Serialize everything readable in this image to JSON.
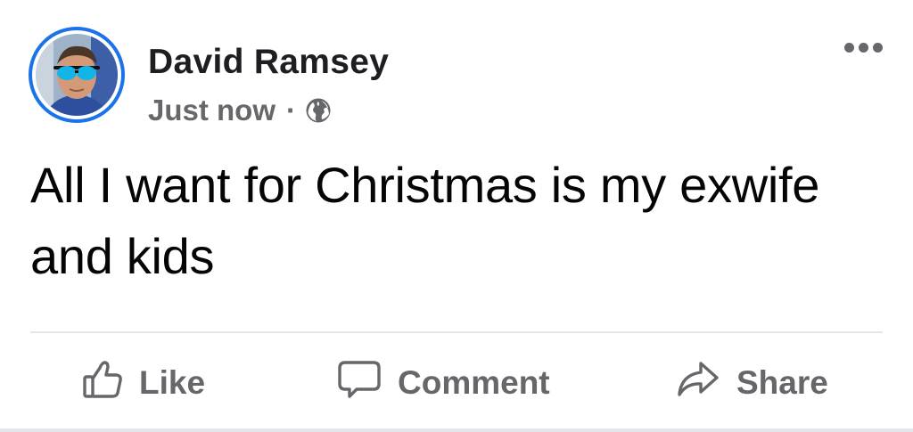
{
  "post": {
    "author": {
      "name": "David Ramsey",
      "avatar_icon": "profile-photo",
      "avatar_ring_color": "#1a73e8"
    },
    "timestamp": "Just now",
    "separator": "·",
    "privacy_icon": "globe-icon",
    "menu_icon": "more-options-icon",
    "text": "All I want for Christmas is my exwife and kids"
  },
  "actions": {
    "like": {
      "label": "Like",
      "icon": "thumbs-up-icon"
    },
    "comment": {
      "label": "Comment",
      "icon": "comment-bubble-icon"
    },
    "share": {
      "label": "Share",
      "icon": "share-arrow-icon"
    }
  },
  "colors": {
    "secondary_text": "#65676b",
    "primary_text": "#050505",
    "accent": "#1a73e8"
  }
}
